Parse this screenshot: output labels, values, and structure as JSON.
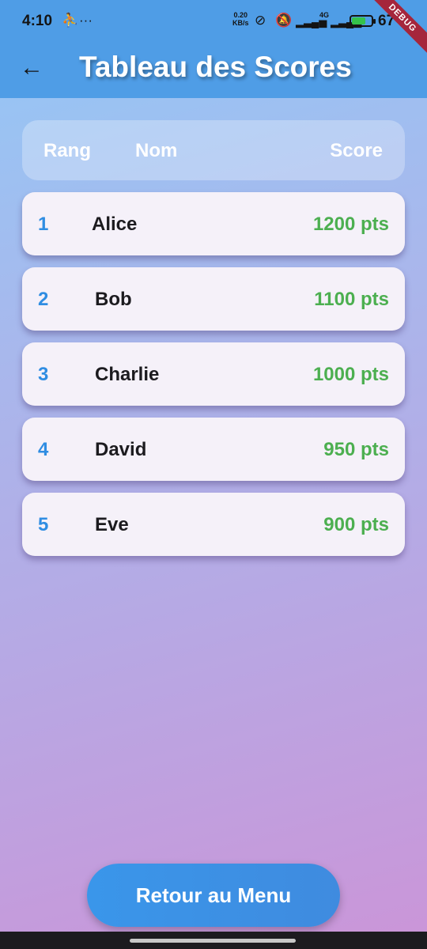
{
  "status_bar": {
    "time": "4:10",
    "dots": "···",
    "speed_value": "0.20",
    "speed_unit": "KB/s",
    "network": "4G",
    "battery": "67",
    "debug_banner": "DEBUG"
  },
  "app_bar": {
    "title": "Tableau des Scores"
  },
  "table": {
    "headers": {
      "rank": "Rang",
      "name": "Nom",
      "score": "Score"
    },
    "rows": [
      {
        "rank": "1",
        "name": "Alice",
        "score": "1200 pts"
      },
      {
        "rank": "2",
        "name": "Bob",
        "score": "1100 pts"
      },
      {
        "rank": "3",
        "name": "Charlie",
        "score": "1000 pts"
      },
      {
        "rank": "4",
        "name": "David",
        "score": "950 pts"
      },
      {
        "rank": "5",
        "name": "Eve",
        "score": "900 pts"
      }
    ]
  },
  "back_button_label": "Retour au Menu",
  "colors": {
    "app_bar": "#4f9de6",
    "rank": "#2f8de2",
    "score": "#4caf50",
    "button": "#3a96ea",
    "card": "#f5f1f9"
  }
}
